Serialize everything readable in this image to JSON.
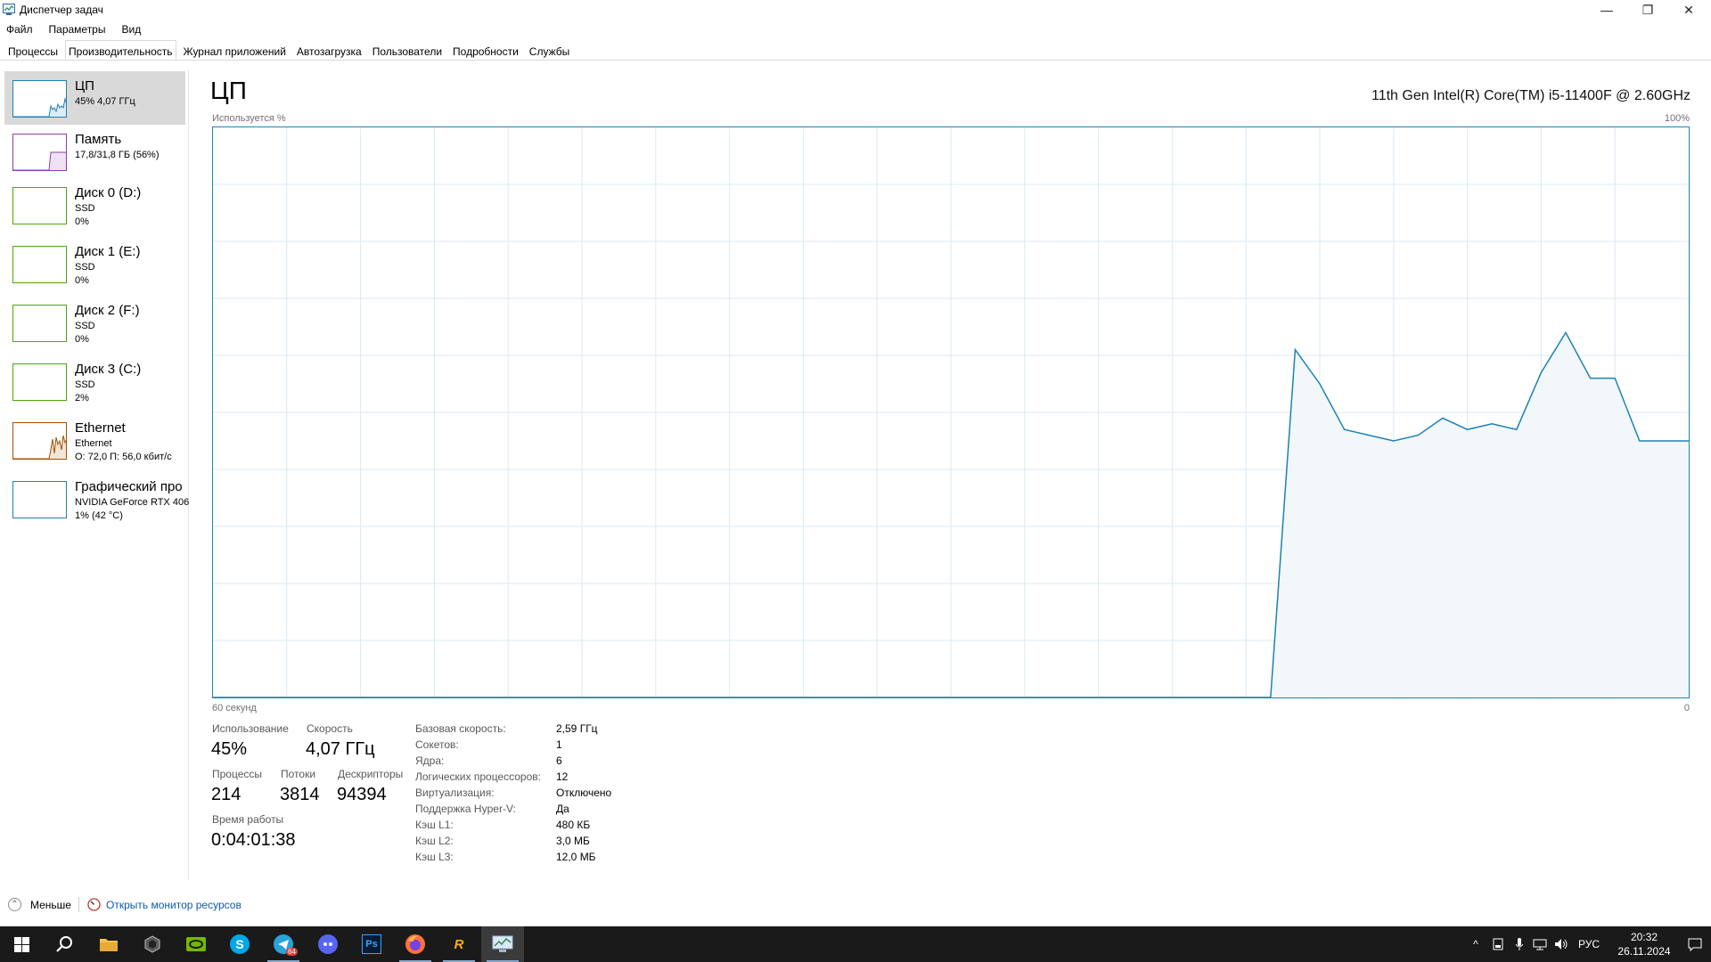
{
  "window": {
    "title": "Диспетчер задач",
    "minimize_glyph": "—",
    "restore_glyph": "❐",
    "close_glyph": "✕"
  },
  "menu": [
    "Файл",
    "Параметры",
    "Вид"
  ],
  "tabs": [
    {
      "label": "Процессы",
      "active": false
    },
    {
      "label": "Производительность",
      "active": true
    },
    {
      "label": "Журнал приложений",
      "active": false
    },
    {
      "label": "Автозагрузка",
      "active": false
    },
    {
      "label": "Пользователи",
      "active": false
    },
    {
      "label": "Подробности",
      "active": false
    },
    {
      "label": "Службы",
      "active": false
    }
  ],
  "sidebar": {
    "items": [
      {
        "title": "ЦП",
        "lines": [
          "45% 4,07 ГГц"
        ],
        "color": "#1e82b4",
        "icon": "cpu-graph-thumbnail"
      },
      {
        "title": "Память",
        "lines": [
          "17,8/31,8 ГБ (56%)"
        ],
        "color": "#8b3fa8",
        "icon": "memory-graph-thumbnail"
      },
      {
        "title": "Диск 0 (D:)",
        "lines": [
          "SSD",
          "0%"
        ],
        "color": "#4da60c",
        "icon": "disk-graph-thumbnail"
      },
      {
        "title": "Диск 1 (E:)",
        "lines": [
          "SSD",
          "0%"
        ],
        "color": "#4da60c",
        "icon": "disk-graph-thumbnail"
      },
      {
        "title": "Диск 2 (F:)",
        "lines": [
          "SSD",
          "0%"
        ],
        "color": "#4da60c",
        "icon": "disk-graph-thumbnail"
      },
      {
        "title": "Диск 3 (C:)",
        "lines": [
          "SSD",
          "2%"
        ],
        "color": "#4da60c",
        "icon": "disk-graph-thumbnail"
      },
      {
        "title": "Ethernet",
        "lines": [
          "Ethernet",
          "О: 72,0 П: 56,0 кбит/с"
        ],
        "color": "#a74f01",
        "icon": "network-graph-thumbnail"
      },
      {
        "title": "Графический про",
        "lines": [
          "NVIDIA GeForce RTX 406",
          "1% (42 °C)"
        ],
        "color": "#1e82b4",
        "icon": "gpu-graph-thumbnail"
      }
    ]
  },
  "main": {
    "title": "ЦП",
    "cpu_model": "11th Gen Intel(R) Core(TM) i5-11400F @ 2.60GHz",
    "graph_label_top_left": "Используется %",
    "graph_label_top_right": "100%",
    "graph_label_bottom_left": "60 секунд",
    "graph_label_bottom_right": "0",
    "graph_color": "#1e82b4",
    "graph_fill": "#f1f6fa",
    "grid_color": "#d9eaf4",
    "stats": {
      "usage_label": "Использование",
      "usage_value": "45%",
      "speed_label": "Скорость",
      "speed_value": "4,07 ГГц",
      "processes_label": "Процессы",
      "processes_value": "214",
      "threads_label": "Потоки",
      "threads_value": "3814",
      "handles_label": "Дескрипторы",
      "handles_value": "94394",
      "uptime_label": "Время работы",
      "uptime_value": "0:04:01:38"
    },
    "specs": [
      {
        "label": "Базовая скорость:",
        "value": "2,59 ГГц"
      },
      {
        "label": "Сокетов:",
        "value": "1"
      },
      {
        "label": "Ядра:",
        "value": "6"
      },
      {
        "label": "Логических процессоров:",
        "value": "12"
      },
      {
        "label": "Виртуализация:",
        "value": "Отключено"
      },
      {
        "label": "Поддержка Hyper-V:",
        "value": "Да"
      },
      {
        "label": "Кэш L1:",
        "value": "480 КБ"
      },
      {
        "label": "Кэш L2:",
        "value": "3,0 МБ"
      },
      {
        "label": "Кэш L3:",
        "value": "12,0 МБ"
      }
    ]
  },
  "chart_data": {
    "type": "area",
    "xlabel": "60 секунд",
    "ylabel": "Используется %",
    "ylim": [
      0,
      100
    ],
    "x": [
      60,
      19,
      17,
      16,
      15,
      14,
      13,
      12,
      11,
      10,
      9,
      8,
      7,
      6,
      5,
      4,
      3,
      2,
      1,
      0
    ],
    "values": [
      0,
      0,
      0,
      61,
      55,
      47,
      46,
      45,
      46,
      49,
      47,
      48,
      47,
      57,
      64,
      56,
      56,
      45,
      45,
      45
    ],
    "grid": true,
    "grid_columns": 20,
    "grid_rows": 10
  },
  "footer": {
    "fewer_label": "Меньше",
    "fewer_glyph": "⌃",
    "monitor_link": "Открыть монитор ресурсов"
  },
  "taskbar": {
    "apps": [
      {
        "name": "start-icon"
      },
      {
        "name": "search-icon"
      },
      {
        "name": "file-explorer-icon"
      },
      {
        "name": "unity-hub-icon"
      },
      {
        "name": "nvidia-icon"
      },
      {
        "name": "skype-icon",
        "glyph": "S"
      },
      {
        "name": "telegram-icon",
        "badge": "64"
      },
      {
        "name": "discord-icon"
      },
      {
        "name": "photoshop-icon",
        "glyph": "Ps"
      },
      {
        "name": "firefox-icon"
      },
      {
        "name": "rockstar-launcher-icon",
        "glyph": "R"
      },
      {
        "name": "task-manager-icon"
      }
    ],
    "tray": {
      "chevron": "^",
      "language": "РУС",
      "time": "20:32",
      "date": "26.11.2024"
    }
  }
}
